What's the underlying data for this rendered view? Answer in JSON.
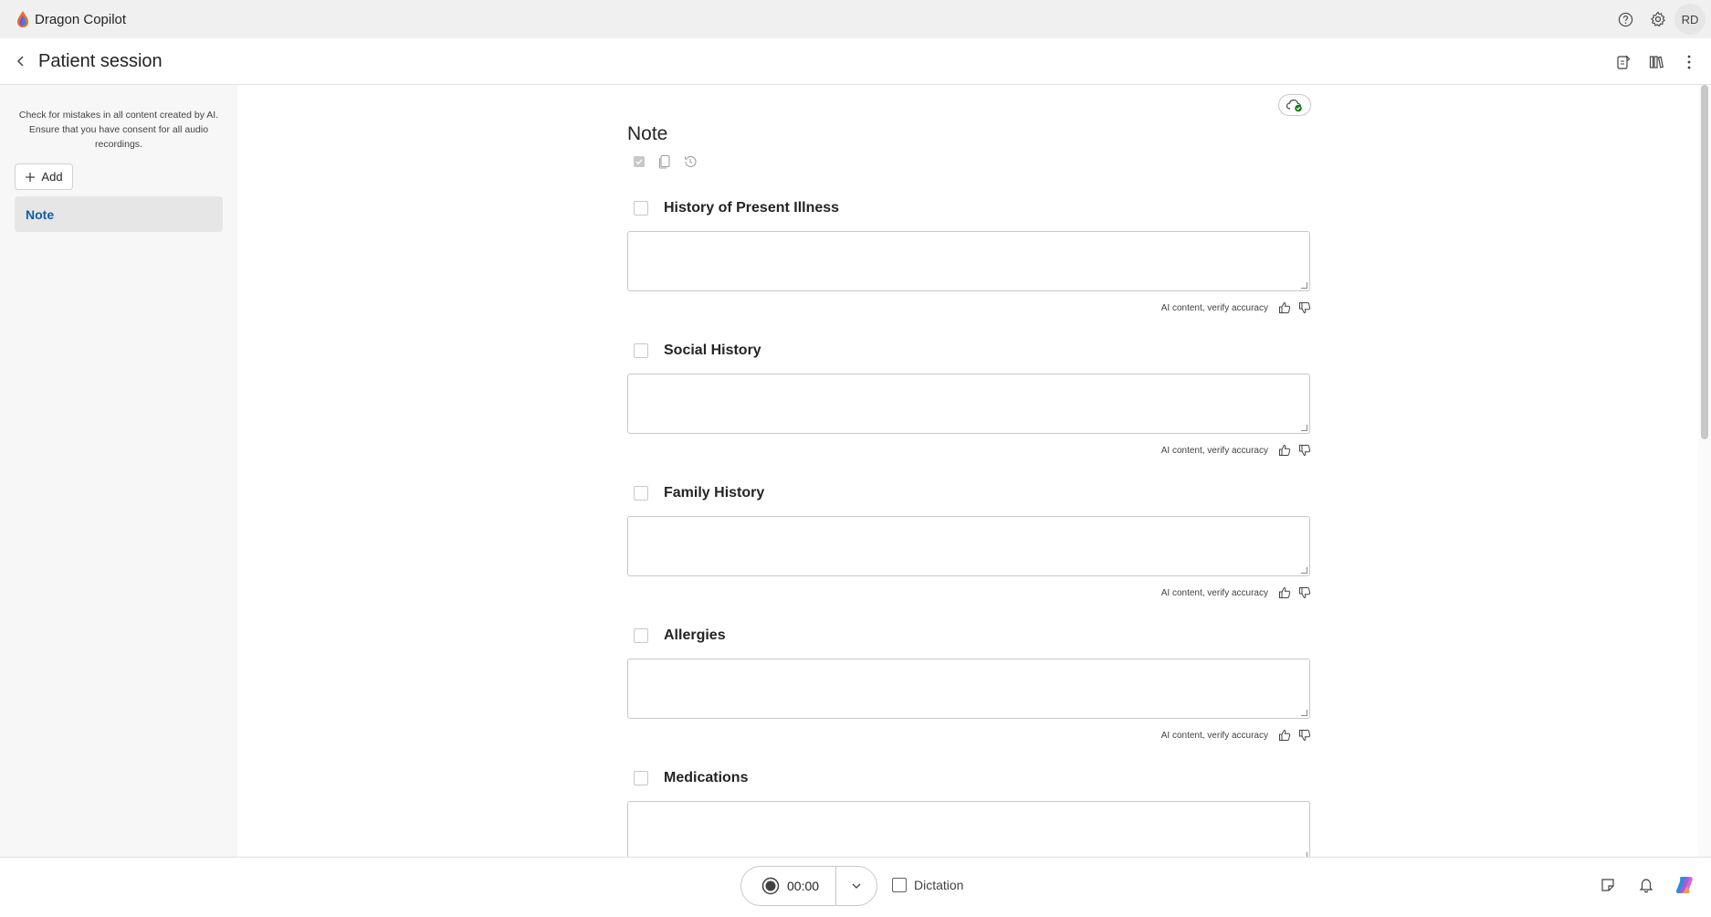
{
  "app": {
    "name": "Dragon Copilot",
    "user_initials": "RD"
  },
  "titlebar_icons": [
    "help-icon",
    "settings-icon"
  ],
  "header": {
    "title": "Patient session",
    "right_icons": [
      "note-edit-icon",
      "library-icon",
      "more-icon"
    ]
  },
  "sidebar": {
    "disclaimer": "Check for mistakes in all content created by AI. Ensure that you have consent for all audio recordings.",
    "add_label": "Add",
    "items": [
      {
        "label": "Note",
        "selected": true
      }
    ]
  },
  "note": {
    "title": "Note",
    "sections": [
      {
        "title": "History of Present Illness",
        "content": "",
        "ai_note": "AI content, verify accuracy"
      },
      {
        "title": "Social History",
        "content": "",
        "ai_note": "AI content, verify accuracy"
      },
      {
        "title": "Family History",
        "content": "",
        "ai_note": "AI content, verify accuracy"
      },
      {
        "title": "Allergies",
        "content": "",
        "ai_note": "AI content, verify accuracy"
      },
      {
        "title": "Medications",
        "content": "",
        "ai_note": ""
      }
    ]
  },
  "footer": {
    "timer": "00:00",
    "dictation_label": "Dictation",
    "dictation_checked": false
  },
  "colors": {
    "accent": "#115ea3",
    "sidebar_bg": "#f7f7f7",
    "titlebar_bg": "#f0f0f0",
    "cloud_ok": "#107c10"
  }
}
